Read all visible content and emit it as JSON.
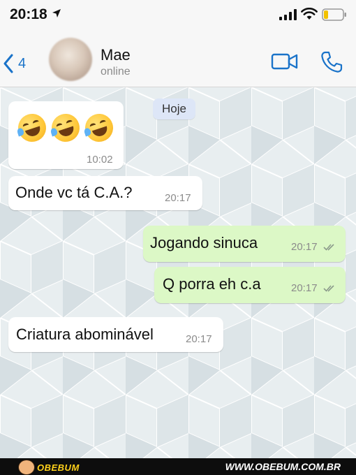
{
  "status_bar": {
    "time": "20:18"
  },
  "header": {
    "back_count": "4",
    "contact_name": "Mae",
    "contact_status": "online"
  },
  "chat": {
    "date_separator": "Hoje",
    "messages": [
      {
        "direction": "in",
        "text": "🤣🤣🤣",
        "time": "10:02"
      },
      {
        "direction": "in",
        "text": "Onde vc tá C.A.?",
        "time": "20:17"
      },
      {
        "direction": "out",
        "text": "Jogando sinuca",
        "time": "20:17",
        "status": "read"
      },
      {
        "direction": "out",
        "text": "Q porra eh c.a",
        "time": "20:17",
        "status": "read"
      },
      {
        "direction": "in",
        "text": "Criatura abominável",
        "time": "20:17"
      }
    ]
  },
  "footer": {
    "brand": "OBEBUM",
    "site": "WWW.OBEBUM.COM.BR"
  },
  "colors": {
    "accent": "#1a73c9",
    "bubble_out": "#dcf8c6",
    "bubble_in": "#ffffff",
    "chat_bg": "#e6ecee"
  },
  "icons": [
    "location-arrow-icon",
    "signal-icon",
    "wifi-icon",
    "battery-icon",
    "chevron-left-icon",
    "video-call-icon",
    "phone-icon",
    "double-check-icon"
  ]
}
